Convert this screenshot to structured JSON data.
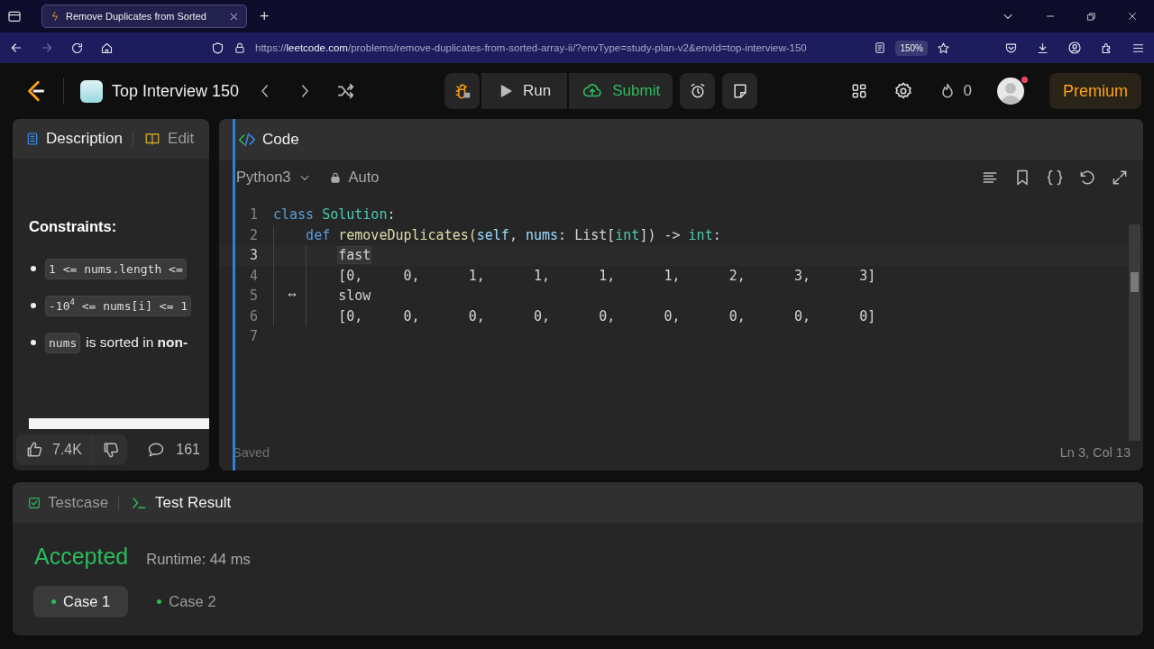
{
  "browser": {
    "tab": {
      "title": "Remove Duplicates from Sorted"
    },
    "new_tab": "+",
    "nav": [
      {
        "kind": "back",
        "disabled": false
      },
      {
        "kind": "forward",
        "disabled": true
      }
    ],
    "url": {
      "scheme": "https://",
      "host": "leetcode.com",
      "path": "/problems/remove-duplicates-from-sorted-array-ii/?envType=study-plan-v2&envId=top-interview-150"
    },
    "zoom": "150%"
  },
  "header": {
    "study_plan": "Top Interview 150",
    "run": "Run",
    "submit": "Submit",
    "streak": "0",
    "notification": true,
    "premium": "Premium"
  },
  "description_panel": {
    "tabs": [
      {
        "label": "Description",
        "kind": "description",
        "selected": true
      },
      {
        "label": "Edit",
        "kind": "editorial",
        "selected": false
      }
    ],
    "heading": "Constraints:",
    "constraints": [
      {
        "code": "1 <= nums.length <="
      },
      {
        "code": "-10$^{4}$ <= nums[i] <= 1"
      },
      {
        "code": "nums",
        "text": "is sorted in **non-**"
      }
    ],
    "likes": "7.4K",
    "comments": "161"
  },
  "code_panel": {
    "title": "Code",
    "language": "Python3",
    "mode": "Auto",
    "lines": [
      {
        "number": "1",
        "current": false,
        "tokens": [
          {
            "text": "class",
            "kind": "keyword"
          },
          {
            "text": " Solution",
            "kind": "class"
          },
          {
            "text": ":",
            "kind": "plain"
          }
        ]
      },
      {
        "number": "2",
        "current": false,
        "tokens": [
          {
            "text": "    def",
            "kind": "keyword"
          },
          {
            "text": " removeDuplicates(",
            "kind": "function"
          },
          {
            "text": "self",
            "kind": "param"
          },
          {
            "text": ", ",
            "kind": "plain"
          },
          {
            "text": "nums",
            "kind": "param"
          },
          {
            "text": ": List[",
            "kind": "plain"
          },
          {
            "text": "int",
            "kind": "class"
          },
          {
            "text": "]) -> ",
            "kind": "plain"
          },
          {
            "text": "int",
            "kind": "class"
          },
          {
            "text": ":",
            "kind": "plain"
          }
        ]
      },
      {
        "number": "3",
        "current": true,
        "tokens": [
          {
            "text": "        fast",
            "kind": "match"
          }
        ]
      },
      {
        "number": "4",
        "current": false,
        "tokens": [
          {
            "text": "        [0,     0,      1,      1,      1,      1,      2,      3,      3]",
            "kind": "plain"
          }
        ]
      },
      {
        "number": "5",
        "current": false,
        "tokens": [
          {
            "text": "        slow",
            "kind": "plain"
          }
        ]
      },
      {
        "number": "6",
        "current": false,
        "tokens": [
          {
            "text": "        [0,     0,      0,      0,      0,      0,      0,      0,      0]",
            "kind": "plain"
          }
        ]
      },
      {
        "number": "7",
        "current": false
      }
    ],
    "status": "Saved",
    "cursor": "Ln 3, Col 13"
  },
  "result_panel": {
    "tabs": [
      {
        "label": "Testcase",
        "kind": "testcase",
        "selected": false
      },
      {
        "label": "Test Result",
        "kind": "result",
        "selected": true
      }
    ],
    "verdict": "Accepted",
    "runtime": "Runtime: 44 ms",
    "cases": [
      {
        "label": "Case 1",
        "selected": true
      },
      {
        "label": "Case 2",
        "selected": false
      }
    ]
  }
}
